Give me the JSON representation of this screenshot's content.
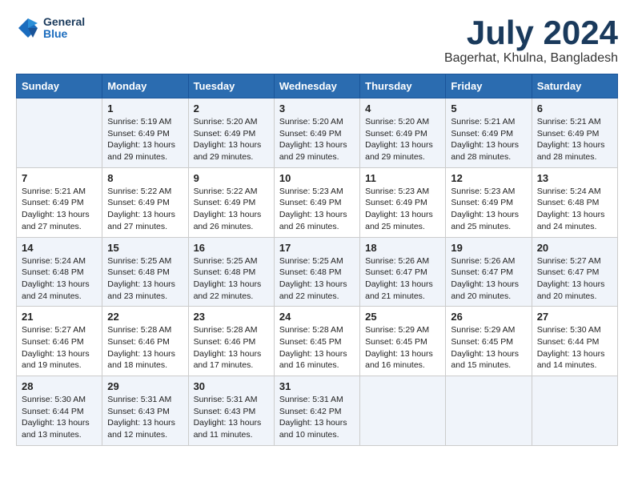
{
  "logo": {
    "line1": "General",
    "line2": "Blue"
  },
  "title": "July 2024",
  "subtitle": "Bagerhat, Khulna, Bangladesh",
  "weekdays": [
    "Sunday",
    "Monday",
    "Tuesday",
    "Wednesday",
    "Thursday",
    "Friday",
    "Saturday"
  ],
  "weeks": [
    [
      {
        "day": "",
        "text": ""
      },
      {
        "day": "1",
        "text": "Sunrise: 5:19 AM\nSunset: 6:49 PM\nDaylight: 13 hours\nand 29 minutes."
      },
      {
        "day": "2",
        "text": "Sunrise: 5:20 AM\nSunset: 6:49 PM\nDaylight: 13 hours\nand 29 minutes."
      },
      {
        "day": "3",
        "text": "Sunrise: 5:20 AM\nSunset: 6:49 PM\nDaylight: 13 hours\nand 29 minutes."
      },
      {
        "day": "4",
        "text": "Sunrise: 5:20 AM\nSunset: 6:49 PM\nDaylight: 13 hours\nand 29 minutes."
      },
      {
        "day": "5",
        "text": "Sunrise: 5:21 AM\nSunset: 6:49 PM\nDaylight: 13 hours\nand 28 minutes."
      },
      {
        "day": "6",
        "text": "Sunrise: 5:21 AM\nSunset: 6:49 PM\nDaylight: 13 hours\nand 28 minutes."
      }
    ],
    [
      {
        "day": "7",
        "text": "Sunrise: 5:21 AM\nSunset: 6:49 PM\nDaylight: 13 hours\nand 27 minutes."
      },
      {
        "day": "8",
        "text": "Sunrise: 5:22 AM\nSunset: 6:49 PM\nDaylight: 13 hours\nand 27 minutes."
      },
      {
        "day": "9",
        "text": "Sunrise: 5:22 AM\nSunset: 6:49 PM\nDaylight: 13 hours\nand 26 minutes."
      },
      {
        "day": "10",
        "text": "Sunrise: 5:23 AM\nSunset: 6:49 PM\nDaylight: 13 hours\nand 26 minutes."
      },
      {
        "day": "11",
        "text": "Sunrise: 5:23 AM\nSunset: 6:49 PM\nDaylight: 13 hours\nand 25 minutes."
      },
      {
        "day": "12",
        "text": "Sunrise: 5:23 AM\nSunset: 6:49 PM\nDaylight: 13 hours\nand 25 minutes."
      },
      {
        "day": "13",
        "text": "Sunrise: 5:24 AM\nSunset: 6:48 PM\nDaylight: 13 hours\nand 24 minutes."
      }
    ],
    [
      {
        "day": "14",
        "text": "Sunrise: 5:24 AM\nSunset: 6:48 PM\nDaylight: 13 hours\nand 24 minutes."
      },
      {
        "day": "15",
        "text": "Sunrise: 5:25 AM\nSunset: 6:48 PM\nDaylight: 13 hours\nand 23 minutes."
      },
      {
        "day": "16",
        "text": "Sunrise: 5:25 AM\nSunset: 6:48 PM\nDaylight: 13 hours\nand 22 minutes."
      },
      {
        "day": "17",
        "text": "Sunrise: 5:25 AM\nSunset: 6:48 PM\nDaylight: 13 hours\nand 22 minutes."
      },
      {
        "day": "18",
        "text": "Sunrise: 5:26 AM\nSunset: 6:47 PM\nDaylight: 13 hours\nand 21 minutes."
      },
      {
        "day": "19",
        "text": "Sunrise: 5:26 AM\nSunset: 6:47 PM\nDaylight: 13 hours\nand 20 minutes."
      },
      {
        "day": "20",
        "text": "Sunrise: 5:27 AM\nSunset: 6:47 PM\nDaylight: 13 hours\nand 20 minutes."
      }
    ],
    [
      {
        "day": "21",
        "text": "Sunrise: 5:27 AM\nSunset: 6:46 PM\nDaylight: 13 hours\nand 19 minutes."
      },
      {
        "day": "22",
        "text": "Sunrise: 5:28 AM\nSunset: 6:46 PM\nDaylight: 13 hours\nand 18 minutes."
      },
      {
        "day": "23",
        "text": "Sunrise: 5:28 AM\nSunset: 6:46 PM\nDaylight: 13 hours\nand 17 minutes."
      },
      {
        "day": "24",
        "text": "Sunrise: 5:28 AM\nSunset: 6:45 PM\nDaylight: 13 hours\nand 16 minutes."
      },
      {
        "day": "25",
        "text": "Sunrise: 5:29 AM\nSunset: 6:45 PM\nDaylight: 13 hours\nand 16 minutes."
      },
      {
        "day": "26",
        "text": "Sunrise: 5:29 AM\nSunset: 6:45 PM\nDaylight: 13 hours\nand 15 minutes."
      },
      {
        "day": "27",
        "text": "Sunrise: 5:30 AM\nSunset: 6:44 PM\nDaylight: 13 hours\nand 14 minutes."
      }
    ],
    [
      {
        "day": "28",
        "text": "Sunrise: 5:30 AM\nSunset: 6:44 PM\nDaylight: 13 hours\nand 13 minutes."
      },
      {
        "day": "29",
        "text": "Sunrise: 5:31 AM\nSunset: 6:43 PM\nDaylight: 13 hours\nand 12 minutes."
      },
      {
        "day": "30",
        "text": "Sunrise: 5:31 AM\nSunset: 6:43 PM\nDaylight: 13 hours\nand 11 minutes."
      },
      {
        "day": "31",
        "text": "Sunrise: 5:31 AM\nSunset: 6:42 PM\nDaylight: 13 hours\nand 10 minutes."
      },
      {
        "day": "",
        "text": ""
      },
      {
        "day": "",
        "text": ""
      },
      {
        "day": "",
        "text": ""
      }
    ]
  ]
}
